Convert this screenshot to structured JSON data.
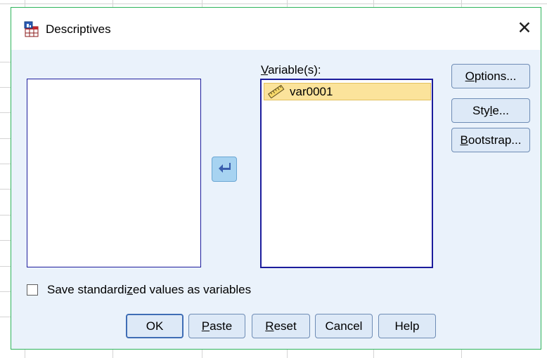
{
  "dialog": {
    "title": "Descriptives",
    "close_glyph": "✕",
    "icon": "descriptives-app-icon"
  },
  "variables": {
    "label_prefix": "",
    "label_mnemonic": "V",
    "label_rest": "ariable(s):",
    "items": [
      {
        "name": "var0001",
        "icon": "ruler-icon",
        "selected": true
      }
    ]
  },
  "move_button": {
    "icon": "arrow-left-icon"
  },
  "side_buttons": {
    "options": {
      "before": "",
      "mnemonic": "O",
      "after": "ptions..."
    },
    "style": {
      "before": "Sty",
      "mnemonic": "l",
      "after": "e..."
    },
    "bootstrap": {
      "before": "",
      "mnemonic": "B",
      "after": "ootstrap..."
    }
  },
  "checkbox": {
    "before": "Save standardi",
    "mnemonic": "z",
    "after": "ed values as variables",
    "checked": false
  },
  "footer_buttons": {
    "ok": {
      "before": "OK",
      "mnemonic": "",
      "after": ""
    },
    "paste": {
      "before": "",
      "mnemonic": "P",
      "after": "aste"
    },
    "reset": {
      "before": "",
      "mnemonic": "R",
      "after": "eset"
    },
    "cancel": {
      "before": "Cancel",
      "mnemonic": "",
      "after": ""
    },
    "help": {
      "before": "Help",
      "mnemonic": "",
      "after": ""
    }
  },
  "colors": {
    "dialog_bg": "#eaf2fb",
    "selection": "#fbe39b",
    "list_border": "#1c1c9c",
    "window_border": "#2eb35a"
  }
}
